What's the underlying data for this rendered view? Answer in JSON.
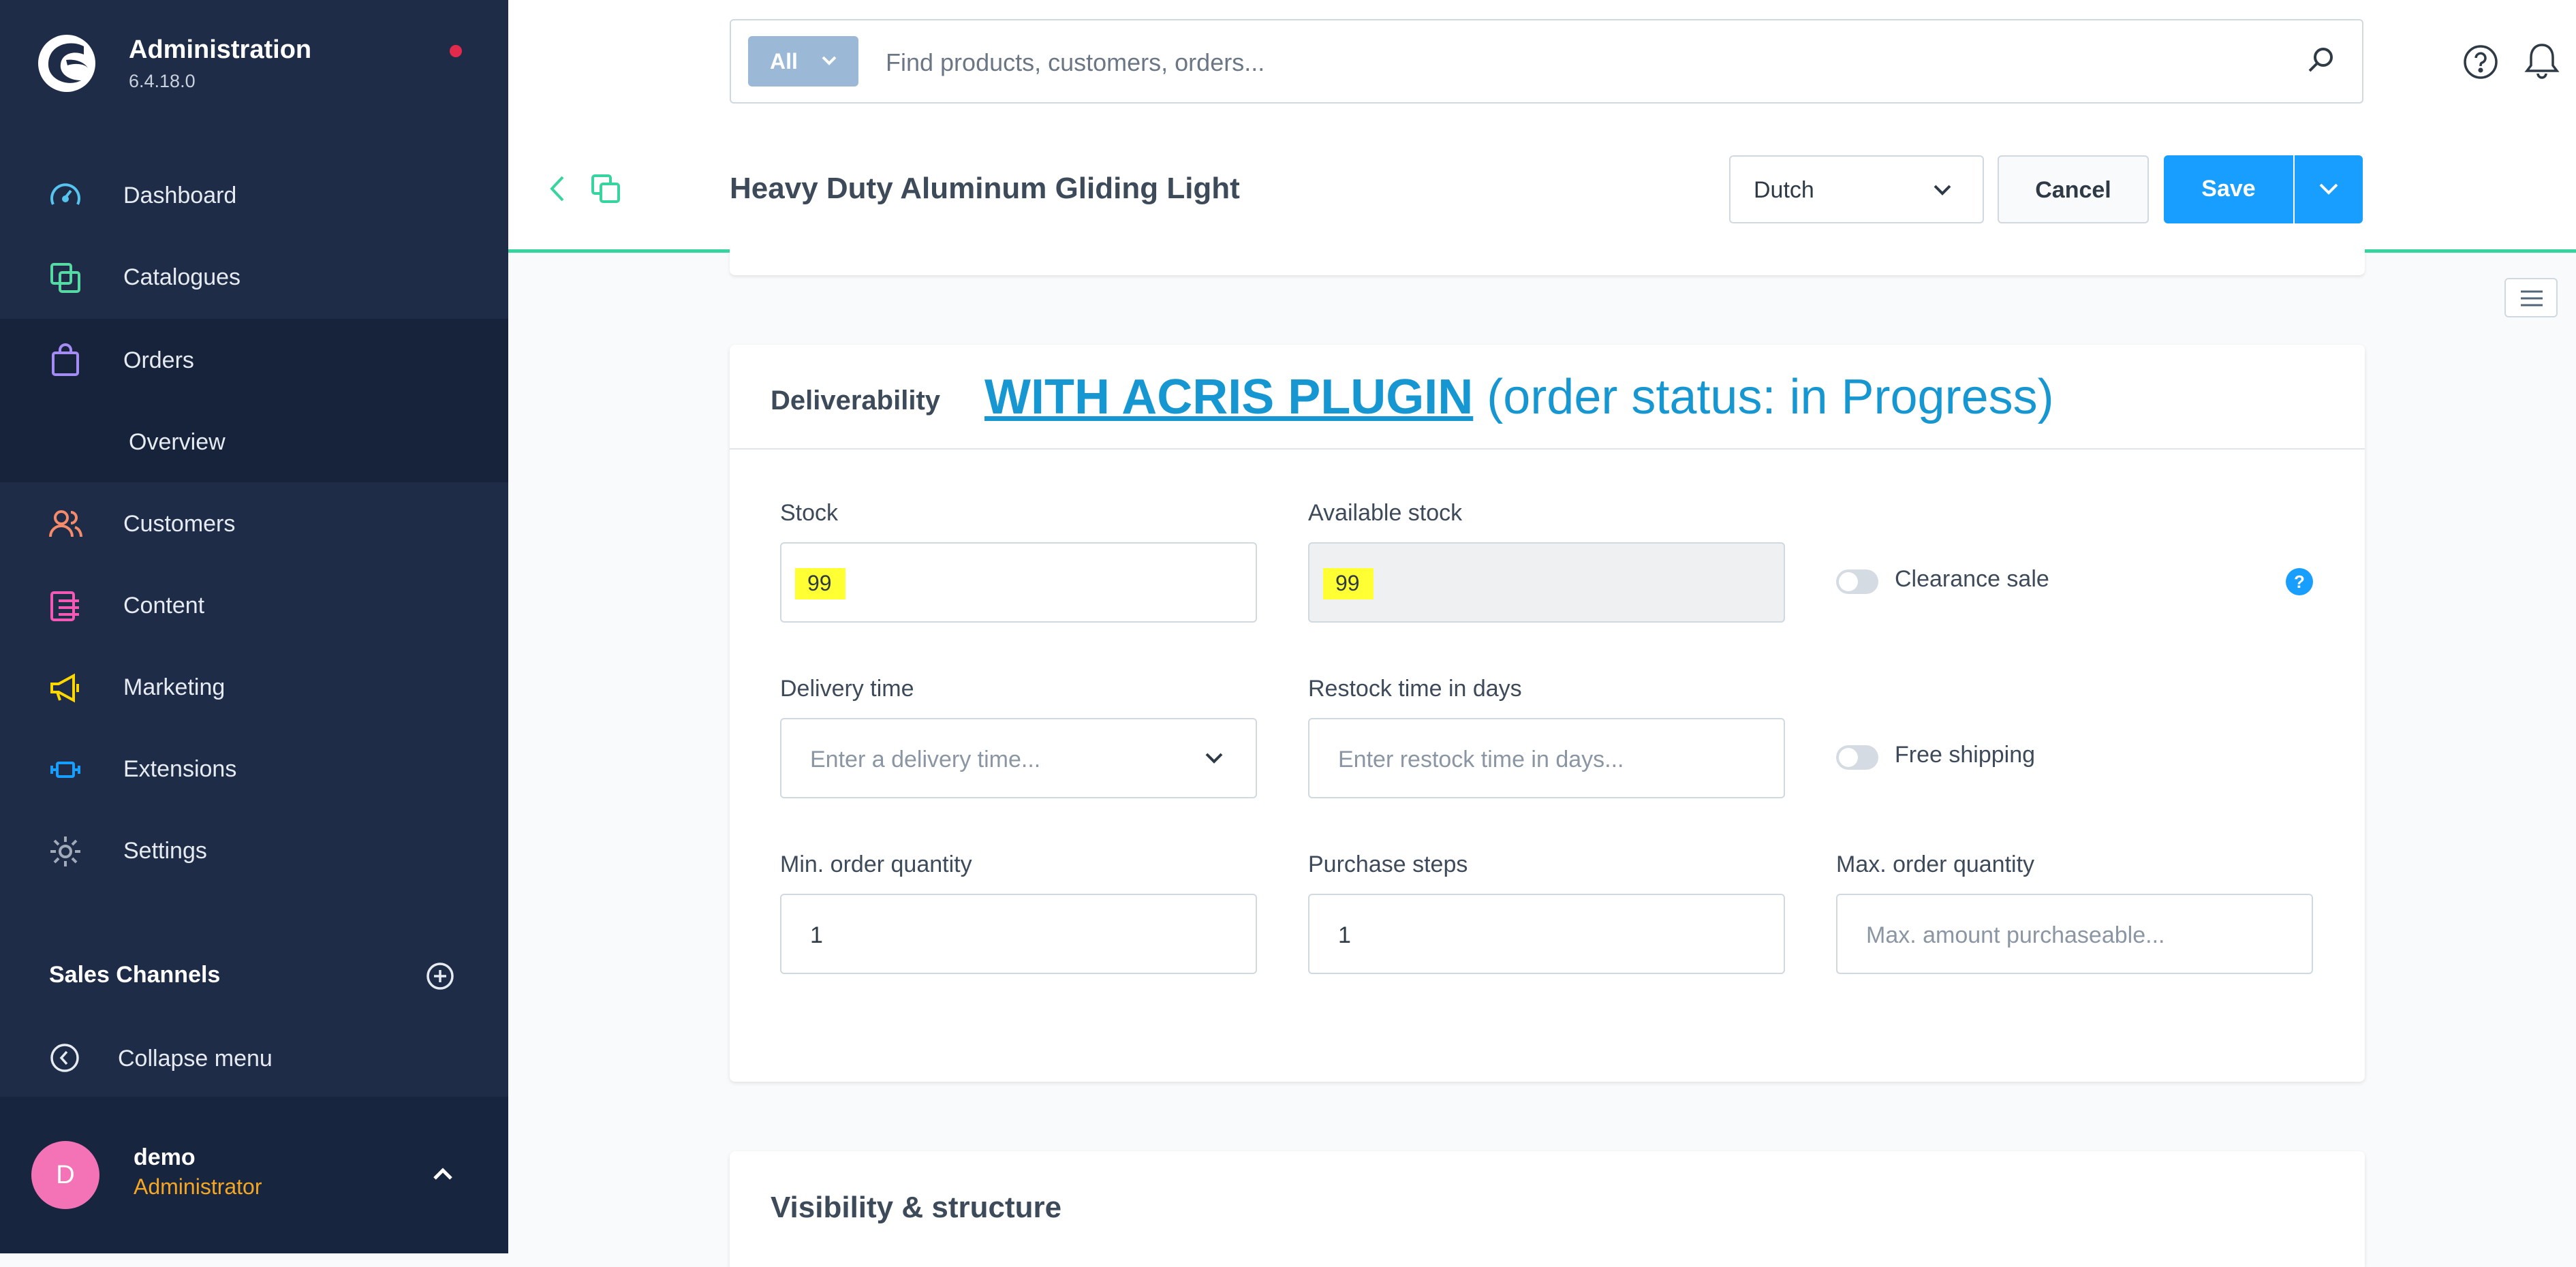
{
  "app": {
    "title": "Administration",
    "version": "6.4.18.0"
  },
  "sidebar": {
    "items": [
      {
        "label": "Dashboard",
        "icon": "dashboard-icon"
      },
      {
        "label": "Catalogues",
        "icon": "catalogues-icon"
      },
      {
        "label": "Orders",
        "icon": "orders-icon",
        "active": true
      },
      {
        "label": "Customers",
        "icon": "customers-icon"
      },
      {
        "label": "Content",
        "icon": "content-icon"
      },
      {
        "label": "Marketing",
        "icon": "marketing-icon"
      },
      {
        "label": "Extensions",
        "icon": "extensions-icon"
      },
      {
        "label": "Settings",
        "icon": "settings-icon"
      }
    ],
    "orders_sub": {
      "label": "Overview"
    },
    "sales_channels": "Sales Channels",
    "collapse": "Collapse menu",
    "user": {
      "initial": "D",
      "name": "demo",
      "role": "Administrator"
    }
  },
  "search": {
    "type_label": "All",
    "placeholder": "Find products, customers, orders..."
  },
  "header": {
    "title": "Heavy Duty Aluminum Gliding Light",
    "language": "Dutch",
    "cancel": "Cancel",
    "save": "Save"
  },
  "deliverability": {
    "title": "Deliverability",
    "annotation_strong": "WITH ACRIS PLUGIN",
    "annotation_rest": " (order status: in Progress)",
    "stock": {
      "label": "Stock",
      "value": "99"
    },
    "available_stock": {
      "label": "Available stock",
      "value": "99"
    },
    "clearance_sale": "Clearance sale",
    "info": "?",
    "delivery_time": {
      "label": "Delivery time",
      "placeholder": "Enter a delivery time..."
    },
    "restock": {
      "label": "Restock time in days",
      "placeholder": "Enter restock time in days..."
    },
    "free_shipping": "Free shipping",
    "min_order": {
      "label": "Min. order quantity",
      "value": "1"
    },
    "purchase_steps": {
      "label": "Purchase steps",
      "value": "1"
    },
    "max_order": {
      "label": "Max. order quantity",
      "placeholder": "Max. amount purchaseable..."
    }
  },
  "visibility": {
    "title": "Visibility & structure"
  },
  "colors": {
    "sidebar_bg": "#1e2c47",
    "primary": "#189eff",
    "annotation": "#1797d1",
    "highlight": "#ffff33",
    "accent_line": "#37d4a0",
    "avatar": "#f472b6",
    "role": "#f5a623"
  }
}
